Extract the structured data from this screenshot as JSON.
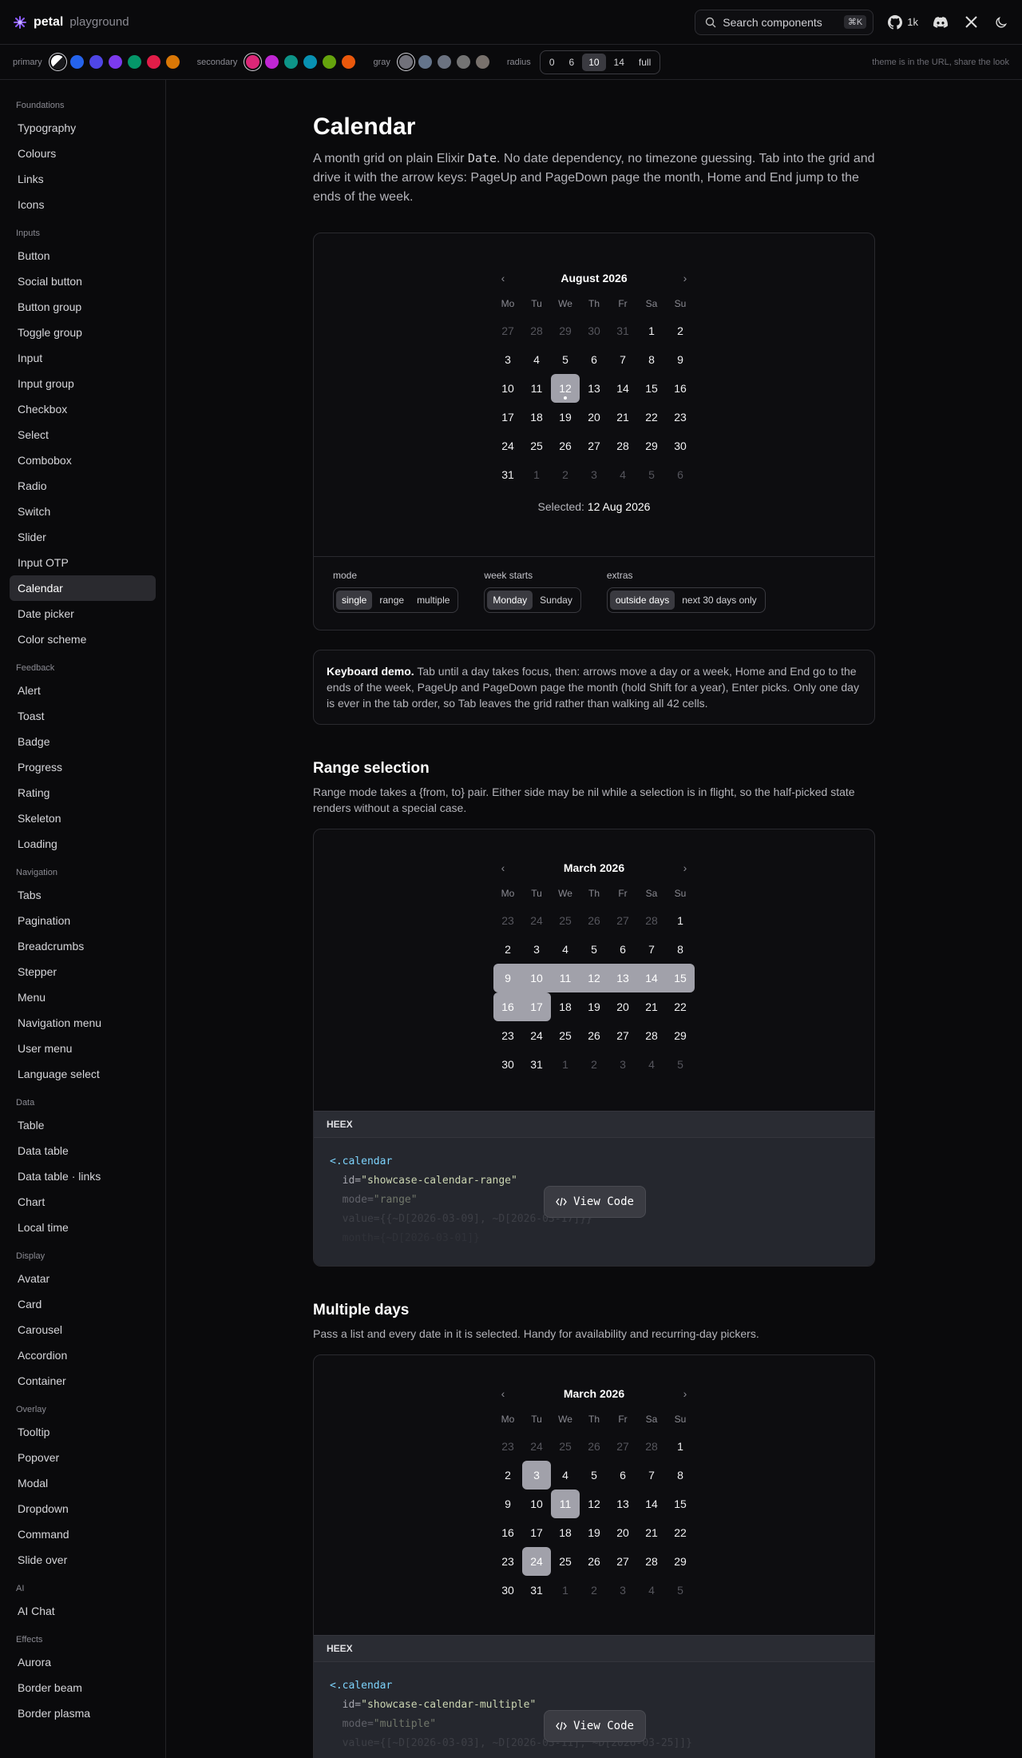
{
  "brand": {
    "name": "petal",
    "sub": "playground"
  },
  "search": {
    "label": "Search components",
    "shortcut": "⌘K"
  },
  "github": {
    "count": "1k"
  },
  "theme": {
    "primary_label": "primary",
    "secondary_label": "secondary",
    "gray_label": "gray",
    "radius_label": "radius",
    "primary_colors": [
      "#2563eb",
      "#4f46e5",
      "#7c3aed",
      "#059669",
      "#e11d48",
      "#d97706"
    ],
    "secondary_colors": [
      "#db2777",
      "#c026d3",
      "#0d9488",
      "#0891b2",
      "#65a30d",
      "#ea580c"
    ],
    "gray_colors": [
      "#71717a",
      "#64748b",
      "#6b7280",
      "#737373",
      "#78716c"
    ],
    "radius_options": [
      "0",
      "6",
      "10",
      "14",
      "full"
    ],
    "radius_selected": "10",
    "note": "theme is in the URL, share the look"
  },
  "sidebar": [
    {
      "title": "Foundations",
      "items": [
        "Typography",
        "Colours",
        "Links",
        "Icons"
      ]
    },
    {
      "title": "Inputs",
      "items": [
        "Button",
        "Social button",
        "Button group",
        "Toggle group",
        "Input",
        "Input group",
        "Checkbox",
        "Select",
        "Combobox",
        "Radio",
        "Switch",
        "Slider",
        "Input OTP",
        "Calendar",
        "Date picker",
        "Color scheme"
      ]
    },
    {
      "title": "Feedback",
      "items": [
        "Alert",
        "Toast",
        "Badge",
        "Progress",
        "Rating",
        "Skeleton",
        "Loading"
      ]
    },
    {
      "title": "Navigation",
      "items": [
        "Tabs",
        "Pagination",
        "Breadcrumbs",
        "Stepper",
        "Menu",
        "Navigation menu",
        "User menu",
        "Language select"
      ]
    },
    {
      "title": "Data",
      "items": [
        "Table",
        "Data table",
        "Data table · links",
        "Chart",
        "Local time"
      ]
    },
    {
      "title": "Display",
      "items": [
        "Avatar",
        "Card",
        "Carousel",
        "Accordion",
        "Container"
      ]
    },
    {
      "title": "Overlay",
      "items": [
        "Tooltip",
        "Popover",
        "Modal",
        "Dropdown",
        "Command",
        "Slide over"
      ]
    },
    {
      "title": "AI",
      "items": [
        "AI Chat"
      ]
    },
    {
      "title": "Effects",
      "items": [
        "Aurora",
        "Border beam",
        "Border plasma"
      ]
    }
  ],
  "sidebar_active": "Calendar",
  "page": {
    "title": "Calendar",
    "lead_1": "A month grid on plain Elixir ",
    "lead_code": "Date",
    "lead_2": ". No date dependency, no timezone guessing. Tab into the grid and drive it with the arrow keys: PageUp and PageDown page the month, Home and End jump to the ends of the week."
  },
  "weekdays": [
    "Mo",
    "Tu",
    "We",
    "Th",
    "Fr",
    "Sa",
    "Su"
  ],
  "demo": {
    "month": "August 2026",
    "days": [
      "27",
      "28",
      "29",
      "30",
      "31",
      "1",
      "2",
      "3",
      "4",
      "5",
      "6",
      "7",
      "8",
      "9",
      "10",
      "11",
      "12",
      "13",
      "14",
      "15",
      "16",
      "17",
      "18",
      "19",
      "20",
      "21",
      "22",
      "23",
      "24",
      "25",
      "26",
      "27",
      "28",
      "29",
      "30",
      "31",
      "1",
      "2",
      "3",
      "4",
      "5",
      "6"
    ],
    "out_before": 5,
    "out_after_from": 36,
    "selected_index": 16,
    "selected_label": "Selected:",
    "selected_value": "12 Aug 2026",
    "controls": {
      "mode_label": "mode",
      "mode_options": [
        "single",
        "range",
        "multiple"
      ],
      "mode_selected": "single",
      "week_label": "week starts",
      "week_options": [
        "Monday",
        "Sunday"
      ],
      "week_selected": "Monday",
      "extras_label": "extras",
      "extras_options": [
        "outside days",
        "next 30 days only"
      ],
      "extras_selected": "outside days"
    }
  },
  "keyboard": {
    "title": "Keyboard demo.",
    "text": " Tab until a day takes focus, then: arrows move a day or a week, Home and End go to the ends of the week, PageUp and PageDown page the month (hold Shift for a year), Enter picks. Only one day is ever in the tab order, so Tab leaves the grid rather than walking all 42 cells."
  },
  "range": {
    "title": "Range selection",
    "desc": "Range mode takes a {from, to} pair. Either side may be nil while a selection is in flight, so the half-picked state renders without a special case.",
    "month": "March 2026",
    "days": [
      "23",
      "24",
      "25",
      "26",
      "27",
      "28",
      "1",
      "2",
      "3",
      "4",
      "5",
      "6",
      "7",
      "8",
      "9",
      "10",
      "11",
      "12",
      "13",
      "14",
      "15",
      "16",
      "17",
      "18",
      "19",
      "20",
      "21",
      "22",
      "23",
      "24",
      "25",
      "26",
      "27",
      "28",
      "29",
      "30",
      "31",
      "1",
      "2",
      "3",
      "4",
      "5"
    ],
    "out_before": 6,
    "out_after_from": 37,
    "range_from": 14,
    "range_to": 22,
    "code": {
      "bar": "HEEX",
      "line1_tag": "<.calendar",
      "line2_attr": "id=",
      "line2_str": "\"showcase-calendar-range\"",
      "line3_attr": "mode=",
      "line3_str": "\"range\"",
      "line4": "value={{~D[2026-03-09], ~D[2026-03-17]}}",
      "line5": "month={~D[2026-03-01]}"
    }
  },
  "multiple": {
    "title": "Multiple days",
    "desc": "Pass a list and every date in it is selected. Handy for availability and recurring-day pickers.",
    "month": "March 2026",
    "days": [
      "23",
      "24",
      "25",
      "26",
      "27",
      "28",
      "1",
      "2",
      "3",
      "4",
      "5",
      "6",
      "7",
      "8",
      "9",
      "10",
      "11",
      "12",
      "13",
      "14",
      "15",
      "16",
      "17",
      "18",
      "19",
      "20",
      "21",
      "22",
      "23",
      "24",
      "25",
      "26",
      "27",
      "28",
      "29",
      "30",
      "31",
      "1",
      "2",
      "3",
      "4",
      "5"
    ],
    "out_before": 6,
    "out_after_from": 37,
    "selected": [
      8,
      16,
      29
    ],
    "code": {
      "bar": "HEEX",
      "line1_tag": "<.calendar",
      "line2_attr": "id=",
      "line2_str": "\"showcase-calendar-multiple\"",
      "line3_attr": "mode=",
      "line3_str": "\"multiple\"",
      "line4": "value={[~D[2026-03-03], ~D[2026-03-11], ~D[2026-03-25]]}"
    }
  },
  "view_code_label": "View Code"
}
